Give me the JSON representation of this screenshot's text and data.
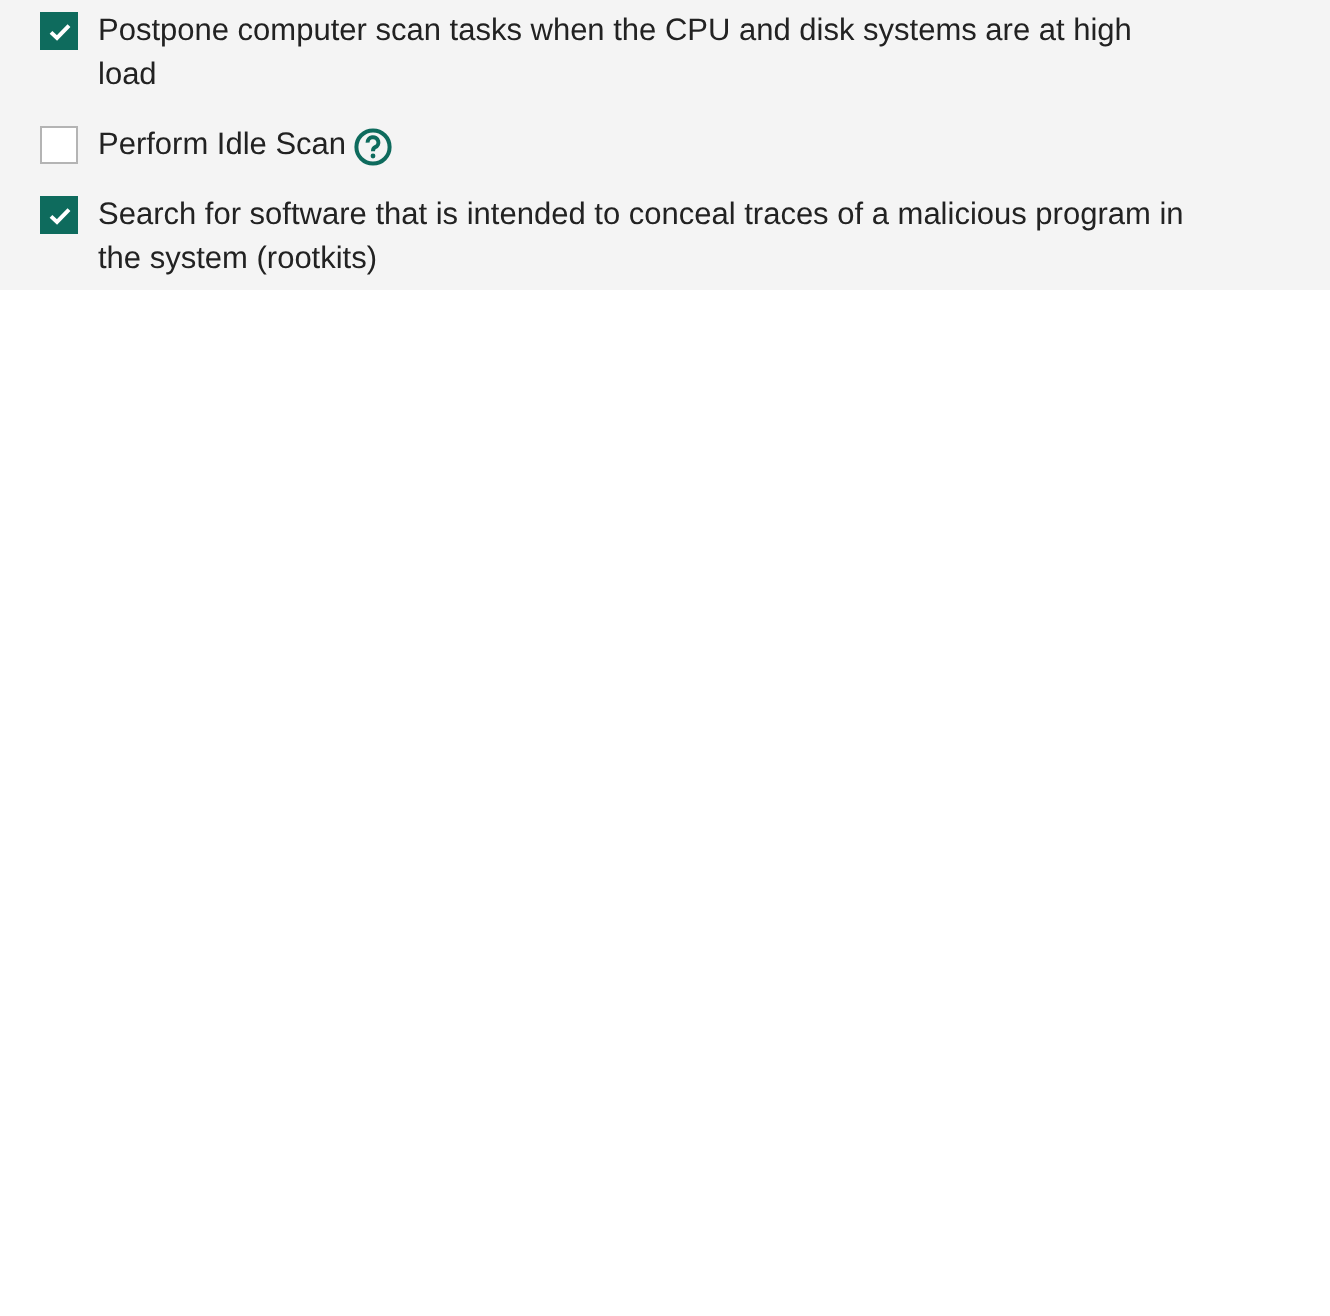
{
  "options": [
    {
      "label": "Postpone computer scan tasks when the CPU and disk systems are at high load",
      "checked": true,
      "help": false
    },
    {
      "label": "Perform Idle Scan",
      "checked": false,
      "help": true
    },
    {
      "label": "Search for software that is intended to conceal traces of a malicious program in the system (rootkits)",
      "checked": true,
      "help": false
    }
  ]
}
